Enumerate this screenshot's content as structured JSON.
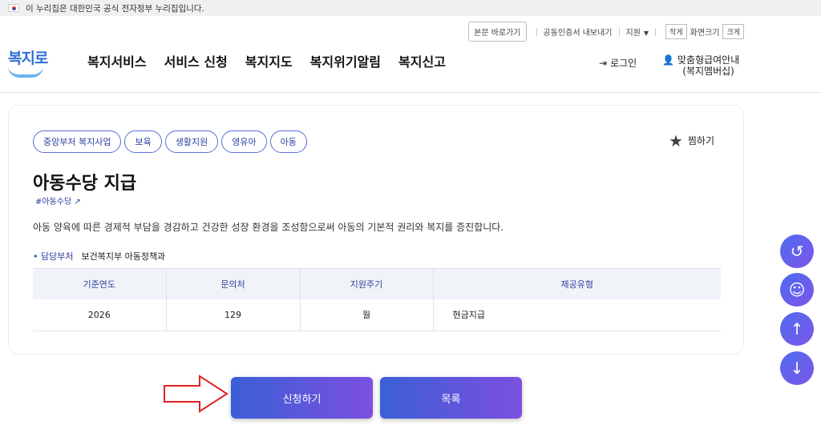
{
  "gov_banner": "이 누리집은 대한민국 공식 전자정부 누리집입니다.",
  "util": {
    "skip": "본문 바로가기",
    "cert": "공동인증서 내보내기",
    "support": "지원",
    "small": "작게",
    "screen_size": "화면크기",
    "large": "크게"
  },
  "logo": "복지로",
  "nav": [
    "복지서비스",
    "서비스 신청",
    "복지지도",
    "복지위기알림",
    "복지신고"
  ],
  "login": "로그인",
  "member_line1": "맞춤형급여안내",
  "member_line2": "(복지멤버십)",
  "tags": [
    "중앙부처 복지사업",
    "보육",
    "생활지원",
    "영유아",
    "아동"
  ],
  "favorite": "찜하기",
  "title": "아동수당 지급",
  "hashtag": "#아동수당",
  "description": "아동 양육에 따른 경제적 부담을 경감하고 건강한 성장 환경을 조성함으로써 아동의 기본적 권리와 복지를 증진합니다.",
  "dept_label": "담당부처",
  "dept_value": "보건복지부 아동정책과",
  "table": {
    "headers": [
      "기준연도",
      "문의처",
      "지원주기",
      "제공유형"
    ],
    "row": [
      "2026",
      "129",
      "월",
      "현금지급"
    ]
  },
  "apply_button": "신청하기",
  "list_button": "목록",
  "colors": {
    "accent": "#2c3e9e",
    "button_start": "#3b5fd6",
    "button_end": "#7c4fe0"
  }
}
